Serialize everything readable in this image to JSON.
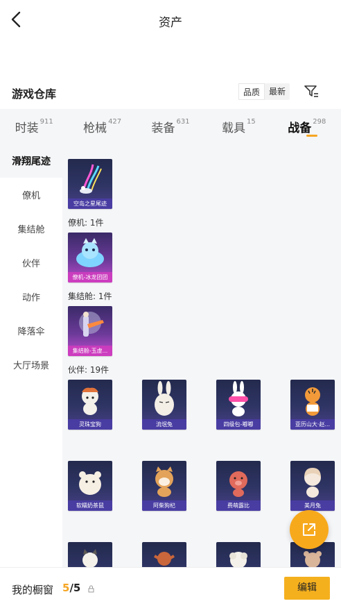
{
  "header": {
    "title": "资产"
  },
  "warehouse": {
    "title": "游戏仓库",
    "sort_quality": "品质",
    "sort_newest": "最新"
  },
  "tabs": [
    {
      "label": "时装",
      "count": "911"
    },
    {
      "label": "枪械",
      "count": "427"
    },
    {
      "label": "装备",
      "count": "631"
    },
    {
      "label": "载具",
      "count": "15"
    },
    {
      "label": "战备",
      "count": "298"
    }
  ],
  "active_tab": "战备",
  "sidebar": [
    "滑翔尾迹",
    "僚机",
    "集结舱",
    "伙伴",
    "动作",
    "降落伞",
    "大厅场景"
  ],
  "active_sidebar": "滑翔尾迹",
  "groups": {
    "wingman": "僚机: 1件",
    "pod": "集结舱: 1件",
    "partner": "伙伴: 19件"
  },
  "items": {
    "trail": "空岛之星尾迹",
    "wingman": "僚机-冰龙团团",
    "pod": "集结舱-玉虚...",
    "partners": [
      "灵珠宝狗",
      "流氓兔",
      "四级包-嘟嘟",
      "亚历山大·赵...",
      "软糯奶茶鼠",
      "阿柴狗杞",
      "费萌露比",
      "美月兔"
    ]
  },
  "bottom": {
    "label": "我的橱窗",
    "count_current": "5",
    "count_total": "/5",
    "edit": "编辑"
  },
  "colors": {
    "accent": "#f5a623",
    "card_dark": "#2f3565",
    "card_pink": "#c04bcf"
  },
  "icons": [
    "back-arrow-icon",
    "filter-icon",
    "share-icon",
    "lock-icon"
  ]
}
